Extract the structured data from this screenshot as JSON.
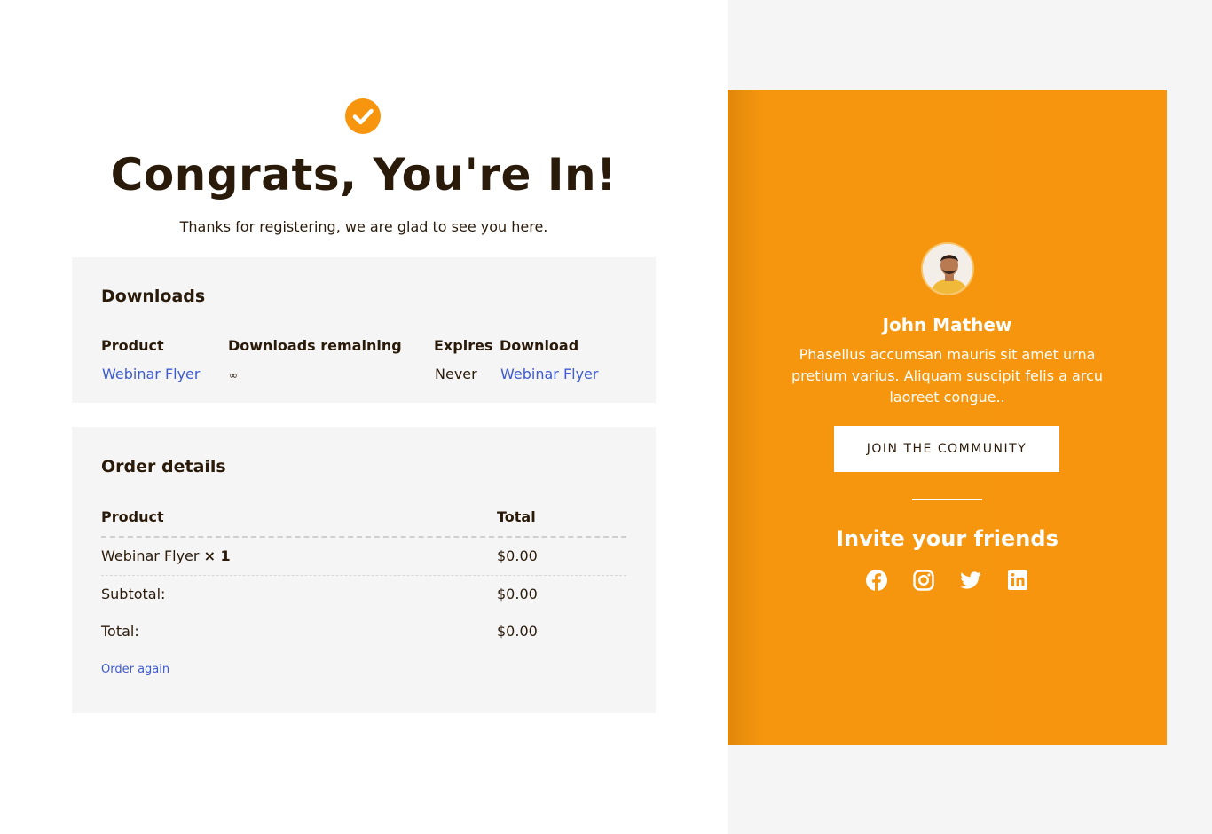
{
  "hero": {
    "title": "Congrats, You're In!",
    "subtitle": "Thanks for registering, we are glad to see you here."
  },
  "downloads": {
    "heading": "Downloads",
    "columns": [
      "Product",
      "Downloads remaining",
      "Expires",
      "Download"
    ],
    "row": {
      "product": "Webinar Flyer",
      "remaining": "∞",
      "expires": "Never",
      "download": "Webinar Flyer"
    }
  },
  "order": {
    "heading": "Order details",
    "columns": [
      "Product",
      "Total"
    ],
    "item": {
      "name": "Webinar Flyer",
      "qty": "× 1",
      "total": "$0.00"
    },
    "subtotal": {
      "label": "Subtotal:",
      "value": "$0.00"
    },
    "total": {
      "label": "Total:",
      "value": "$0.00"
    },
    "order_again": "Order again"
  },
  "profile": {
    "name": "John Mathew",
    "bio": "Phasellus accumsan mauris sit amet urna pretium varius. Aliquam suscipit felis a arcu laoreet congue..",
    "join_button": "JOIN THE COMMUNITY",
    "invite_heading": "Invite your friends",
    "social_icons": [
      "facebook-icon",
      "instagram-icon",
      "twitter-icon",
      "linkedin-icon"
    ]
  },
  "colors": {
    "accent": "#f7960e",
    "link": "#3e5bd0",
    "text": "#2a1a0a",
    "card_bg": "#f5f5f5"
  }
}
